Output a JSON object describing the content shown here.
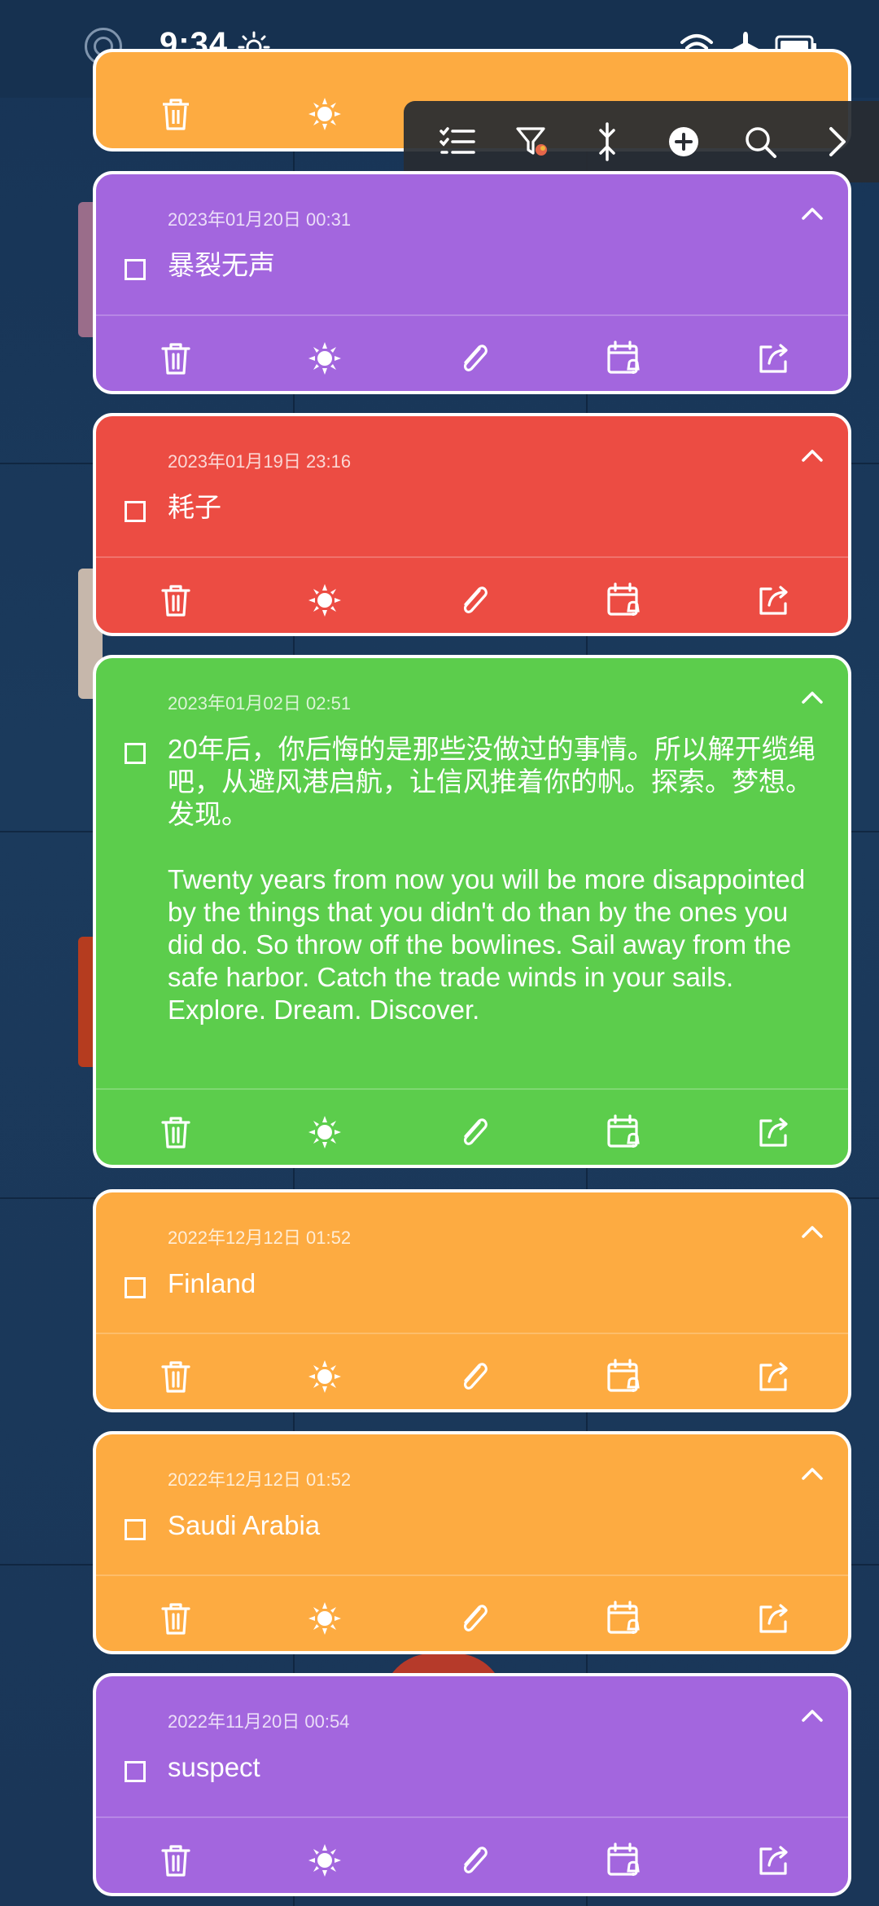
{
  "status_bar": {
    "time": "9:34",
    "icons": [
      "notification-circle-icon",
      "brightness-icon",
      "wifi-icon",
      "airplane-icon",
      "battery-icon"
    ]
  },
  "toolbar": {
    "icons": [
      "checklist-icon",
      "filter-color-icon",
      "collapse-expand-icon",
      "add-circle-icon",
      "search-icon",
      "chevron-right-icon"
    ]
  },
  "notes": [
    {
      "date": "2023年01月20日 00:31",
      "title": "暴裂无声",
      "color": "#a366de"
    },
    {
      "date": "2023年01月19日 23:16",
      "title": "耗子",
      "color": "#ec4c43"
    },
    {
      "date": "2023年01月02日 02:51",
      "title": "20年后，你后悔的是那些没做过的事情。所以解开缆绳吧，从避风港启航，让信风推着你的帆。探索。梦想。发现。\n\nTwenty years from now you will be more disappointed by the things that you didn't do than by the ones you did do. So throw off the bowlines. Sail away from the safe harbor. Catch the trade winds in your sails. Explore. Dream. Discover.",
      "color": "#5ccd4c"
    },
    {
      "date": "2022年12月12日 01:52",
      "title": "Finland",
      "color": "#fdab41"
    },
    {
      "date": "2022年12月12日 01:52",
      "title": "Saudi Arabia",
      "color": "#fdab41"
    },
    {
      "date": "2022年11月20日 00:54",
      "title": "suspect",
      "color": "#a366de"
    }
  ],
  "card_actions": [
    "trash-icon",
    "brightness-icon",
    "attachment-icon",
    "calendar-reminder-icon",
    "share-icon"
  ],
  "colors": {
    "purple": "#a366de",
    "red": "#ec4c43",
    "green": "#5ccd4c",
    "orange": "#fdab41"
  }
}
